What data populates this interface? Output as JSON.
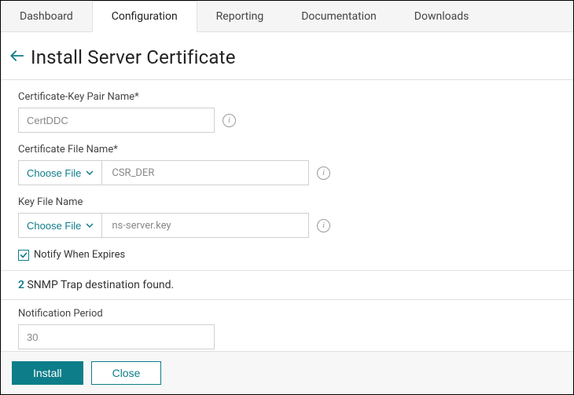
{
  "tabs": {
    "dashboard": "Dashboard",
    "configuration": "Configuration",
    "reporting": "Reporting",
    "documentation": "Documentation",
    "downloads": "Downloads"
  },
  "page_title": "Install Server Certificate",
  "fields": {
    "cert_pair": {
      "label": "Certificate-Key Pair Name*",
      "value": "CertDDC"
    },
    "cert_file": {
      "label": "Certificate File Name*",
      "choose_label": "Choose File",
      "value": "CSR_DER"
    },
    "key_file": {
      "label": "Key File Name",
      "choose_label": "Choose File",
      "value": "ns-server.key"
    },
    "notify": {
      "label": "Notify When Expires"
    },
    "snmp": {
      "count": "2",
      "text": " SNMP Trap destination found."
    },
    "period": {
      "label": "Notification Period",
      "value": "30"
    }
  },
  "buttons": {
    "install": "Install",
    "close": "Close"
  }
}
